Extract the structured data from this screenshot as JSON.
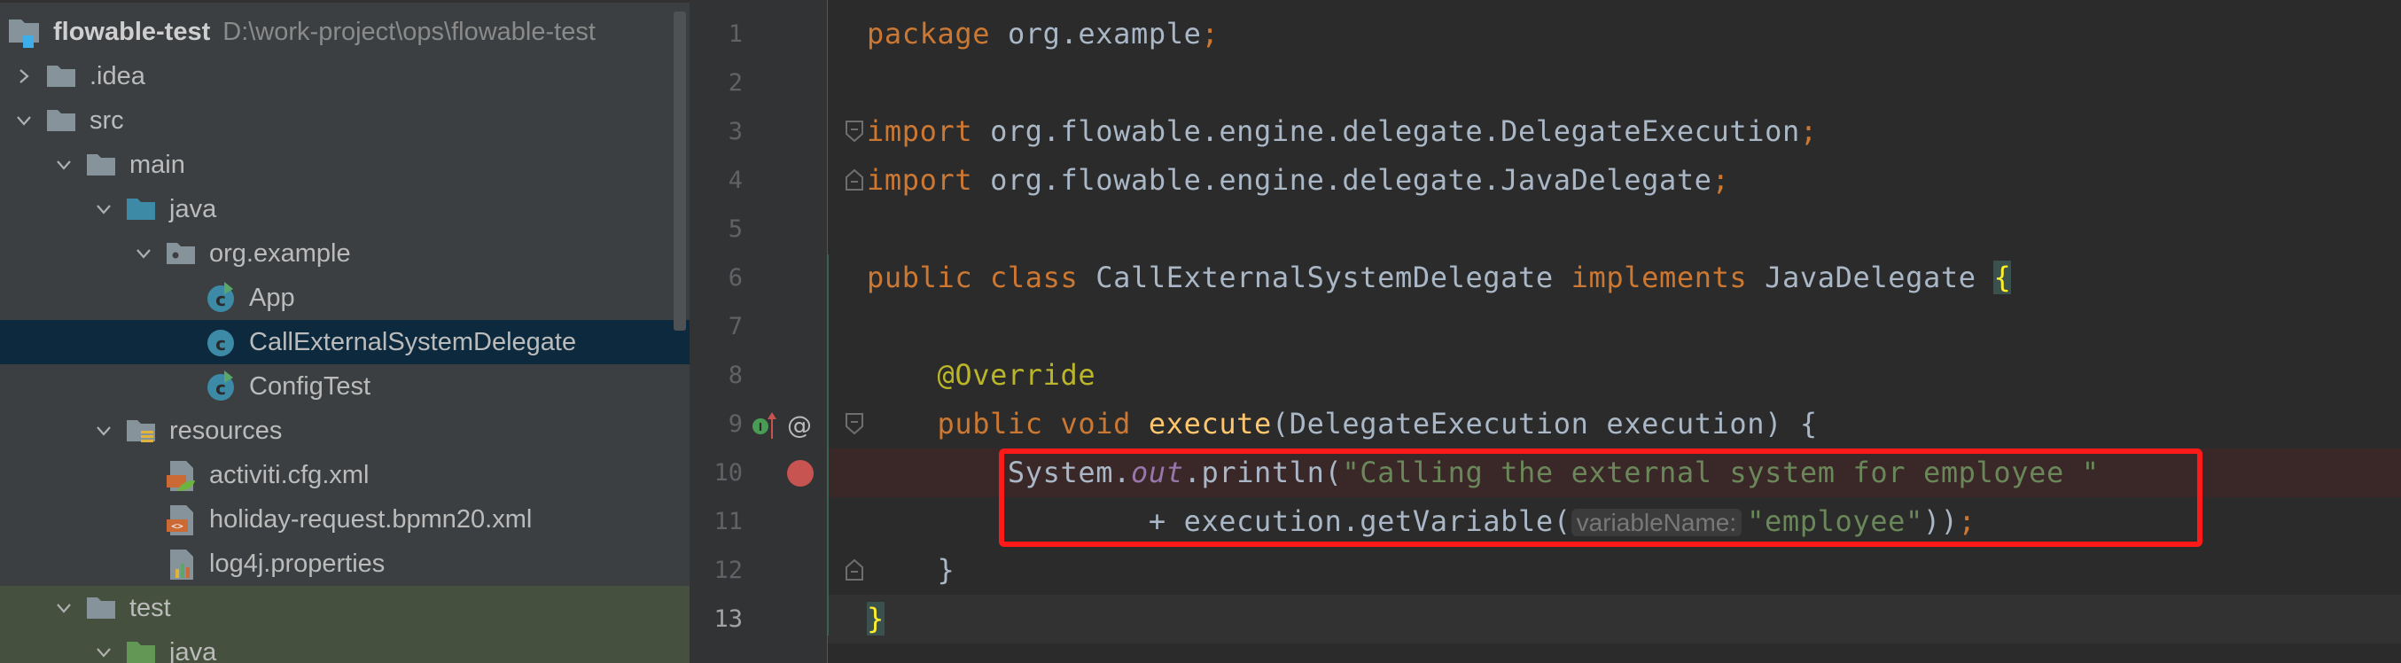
{
  "project": {
    "name": "flowable-test",
    "path": "D:\\work-project\\ops\\flowable-test",
    "tree": [
      {
        "label": ".idea",
        "level": 0,
        "icon": "folder-icon",
        "expanded": false
      },
      {
        "label": "src",
        "level": 0,
        "icon": "folder-icon",
        "expanded": true
      },
      {
        "label": "main",
        "level": 1,
        "icon": "folder-icon",
        "expanded": true
      },
      {
        "label": "java",
        "level": 2,
        "icon": "source-folder-icon",
        "expanded": true
      },
      {
        "label": "org.example",
        "level": 3,
        "icon": "package-icon",
        "expanded": true
      },
      {
        "label": "App",
        "level": 4,
        "icon": "runnable-class-icon"
      },
      {
        "label": "CallExternalSystemDelegate",
        "level": 4,
        "icon": "class-icon",
        "selected": true
      },
      {
        "label": "ConfigTest",
        "level": 4,
        "icon": "runnable-class-icon"
      },
      {
        "label": "resources",
        "level": 2,
        "icon": "resources-folder-icon",
        "expanded": true
      },
      {
        "label": "activiti.cfg.xml",
        "level": 3,
        "icon": "spring-xml-icon"
      },
      {
        "label": "holiday-request.bpmn20.xml",
        "level": 3,
        "icon": "xml-file-icon"
      },
      {
        "label": "log4j.properties",
        "level": 3,
        "icon": "properties-file-icon"
      },
      {
        "label": "test",
        "level": 1,
        "icon": "folder-icon",
        "expanded": true,
        "test": true
      },
      {
        "label": "java",
        "level": 2,
        "icon": "test-folder-icon",
        "expanded": true,
        "test": true
      }
    ]
  },
  "editor": {
    "lines": [
      {
        "n": "1",
        "tokens": [
          {
            "t": "package ",
            "c": "kw"
          },
          {
            "t": "org.example",
            "c": "pl"
          },
          {
            "t": ";",
            "c": "kw"
          }
        ]
      },
      {
        "n": "2",
        "tokens": []
      },
      {
        "n": "3",
        "tokens": [
          {
            "t": "import ",
            "c": "kw"
          },
          {
            "t": "org.flowable.engine.delegate.DelegateExecution",
            "c": "pl"
          },
          {
            "t": ";",
            "c": "kw"
          }
        ],
        "fold": "start"
      },
      {
        "n": "4",
        "tokens": [
          {
            "t": "import ",
            "c": "kw"
          },
          {
            "t": "org.flowable.engine.delegate.JavaDelegate",
            "c": "pl"
          },
          {
            "t": ";",
            "c": "kw"
          }
        ],
        "fold": "end"
      },
      {
        "n": "5",
        "tokens": []
      },
      {
        "n": "6",
        "tokens": [
          {
            "t": "public class ",
            "c": "kw"
          },
          {
            "t": "CallExternalSystemDelegate ",
            "c": "pl"
          },
          {
            "t": "implements ",
            "c": "kw"
          },
          {
            "t": "JavaDelegate ",
            "c": "pl"
          },
          {
            "t": "{",
            "c": "brace"
          }
        ]
      },
      {
        "n": "7",
        "tokens": []
      },
      {
        "n": "8",
        "tokens": [
          {
            "t": "    ",
            "c": "pl"
          },
          {
            "t": "@Override",
            "c": "ann"
          }
        ]
      },
      {
        "n": "9",
        "tokens": [
          {
            "t": "    ",
            "c": "pl"
          },
          {
            "t": "public void ",
            "c": "kw"
          },
          {
            "t": "execute",
            "c": "fn"
          },
          {
            "t": "(DelegateExecution execution) {",
            "c": "pl"
          }
        ],
        "fold": "start",
        "markers": [
          "implements-method-icon",
          "annotation-icon"
        ]
      },
      {
        "n": "10",
        "tokens": [
          {
            "t": "        System.",
            "c": "pl"
          },
          {
            "t": "out",
            "c": "fld"
          },
          {
            "t": ".println(",
            "c": "pl"
          },
          {
            "t": "\"Calling the external system for employee \"",
            "c": "str"
          }
        ],
        "breakpoint": true
      },
      {
        "n": "11",
        "tokens": [
          {
            "t": "                + execution.getVariable(",
            "c": "pl"
          },
          {
            "t": "variableName:",
            "c": "hint"
          },
          {
            "t": "\"employee\"",
            "c": "str"
          },
          {
            "t": "))",
            "c": "pl"
          },
          {
            "t": ";",
            "c": "kw"
          }
        ]
      },
      {
        "n": "12",
        "tokens": [
          {
            "t": "    }",
            "c": "pl"
          }
        ],
        "fold": "end"
      },
      {
        "n": "13",
        "tokens": [
          {
            "t": "}",
            "c": "brace"
          }
        ],
        "current": true
      }
    ]
  },
  "colors": {
    "highlight_box": "#ff1a1a",
    "selection": "#0d293e",
    "breakpoint": "#c75450"
  }
}
